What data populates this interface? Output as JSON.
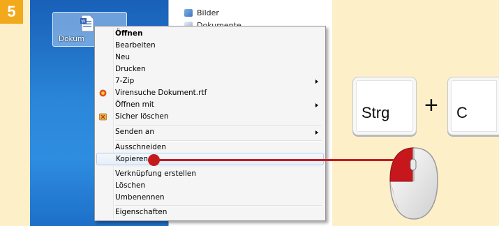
{
  "step": {
    "number": "5"
  },
  "desktop": {
    "icon_label": "Dokum",
    "explorer_items": [
      "Bilder",
      "Dokumente"
    ]
  },
  "context_menu": {
    "items": [
      {
        "label": "Öffnen",
        "bold": true
      },
      {
        "label": "Bearbeiten"
      },
      {
        "label": "Neu"
      },
      {
        "label": "Drucken"
      },
      {
        "label": "7-Zip",
        "submenu": true
      },
      {
        "label": "Virensuche Dokument.rtf",
        "icon": "antivirus-icon"
      },
      {
        "label": "Öffnen mit",
        "submenu": true
      },
      {
        "label": "Sicher löschen",
        "icon": "shredder-icon"
      },
      {
        "label": "Senden an",
        "submenu": true
      },
      {
        "label": "Ausschneiden"
      },
      {
        "label": "Kopieren",
        "highlighted": true
      },
      {
        "label": "Verknüpfung erstellen"
      },
      {
        "label": "Löschen"
      },
      {
        "label": "Umbenennen"
      },
      {
        "label": "Eigenschaften"
      }
    ]
  },
  "shortcut": {
    "key1": "Strg",
    "plus": "+",
    "key2": "C"
  },
  "colors": {
    "badge": "#f3a91c",
    "pointer": "#c41a1f",
    "background": "#fdf0c9"
  }
}
